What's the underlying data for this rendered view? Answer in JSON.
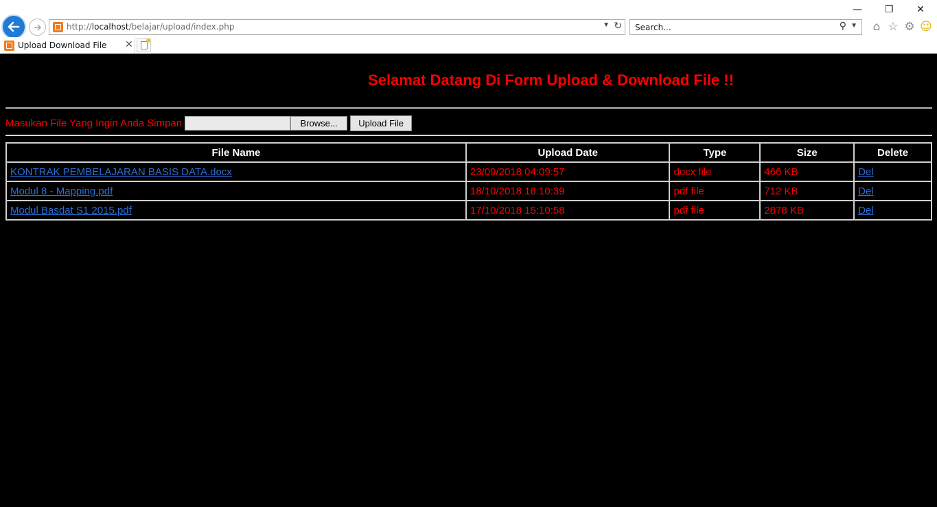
{
  "browser": {
    "url_prefix": "http://",
    "url_host": "localhost",
    "url_path": "/belajar/upload/index.php",
    "search_placeholder": "Search...",
    "tab_title": "Upload Download File",
    "window_controls": {
      "minimize": "—",
      "restore": "❐",
      "close": "✕"
    }
  },
  "page": {
    "heading": "Selamat Datang Di Form Upload & Download File !!",
    "upload_label": "Masukan File Yang Ingin Anda Simpan",
    "file_value": "",
    "browse_label": "Browse...",
    "upload_button": "Upload File"
  },
  "table": {
    "headers": [
      "File Name",
      "Upload Date",
      "Type",
      "Size",
      "Delete"
    ],
    "rows": [
      {
        "name": "KONTRAK PEMBELAJARAN BASIS DATA.docx",
        "date": "23/09/2018 04:09:57",
        "type": "docx file",
        "size": "466 KB",
        "action": "Del"
      },
      {
        "name": "Modul 8 - Mapping.pdf",
        "date": "18/10/2018 16:10:39",
        "type": "pdf file",
        "size": "712 KB",
        "action": "Del"
      },
      {
        "name": "Modul Basdat S1 2015.pdf",
        "date": "17/10/2018 15:10:58",
        "type": "pdf file",
        "size": "2878 KB",
        "action": "Del"
      }
    ]
  },
  "colors": {
    "page_background": "#000000",
    "accent_text": "#ff0000",
    "link": "#2a6fd6",
    "header_text": "#ffffff"
  },
  "icons": [
    "back-arrow-icon",
    "forward-arrow-icon",
    "site-favicon-icon",
    "dropdown-arrow-icon",
    "refresh-icon",
    "search-icon",
    "home-icon",
    "favorites-star-icon",
    "settings-gear-icon",
    "smiley-feedback-icon",
    "tab-close-icon",
    "new-tab-icon"
  ]
}
